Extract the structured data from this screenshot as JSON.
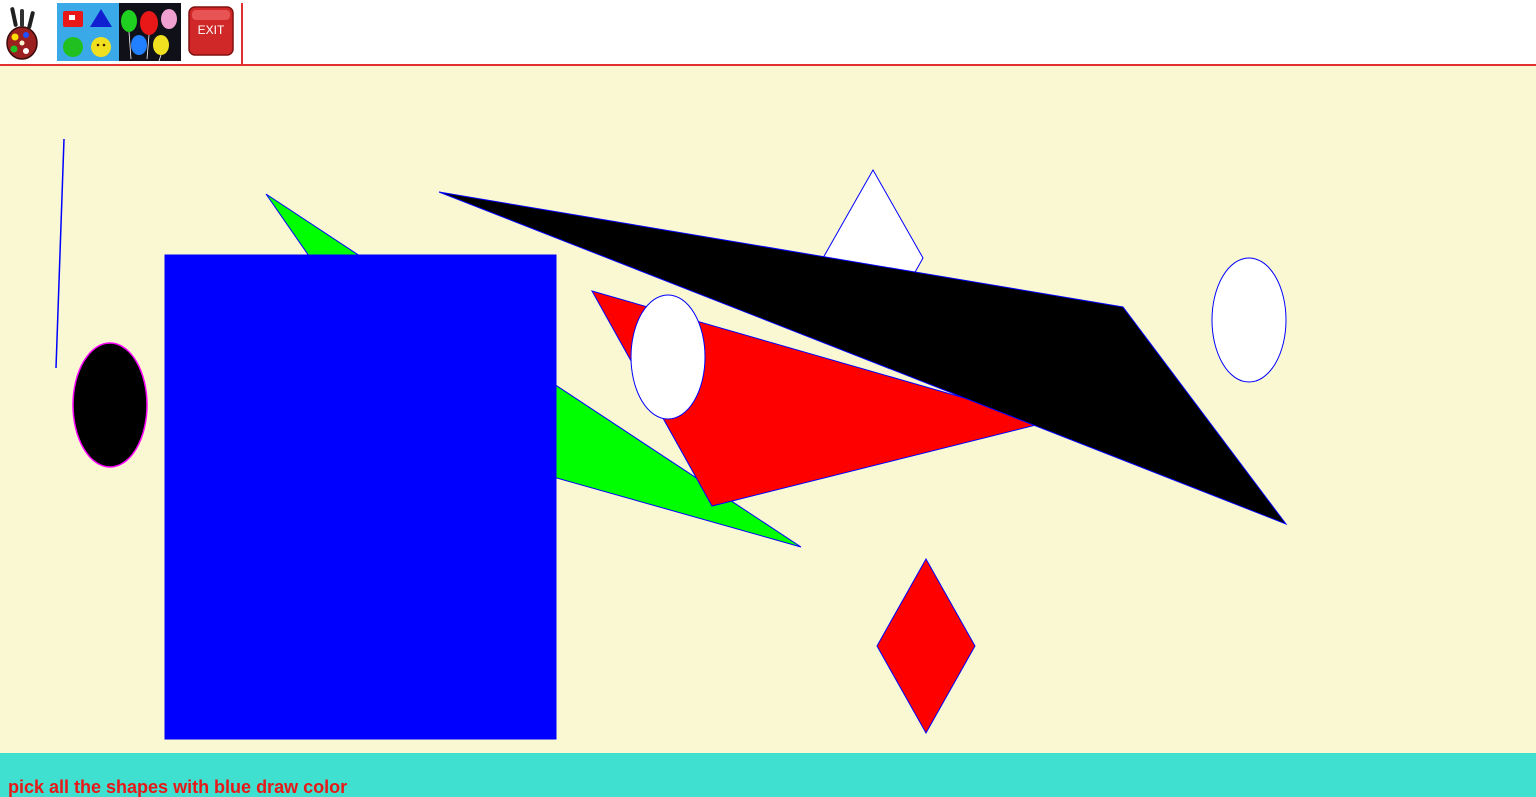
{
  "toolbar": {
    "tools": [
      {
        "name": "palette",
        "icon": "paint-palette-icon"
      },
      {
        "name": "shapes",
        "icon": "shapes-icon"
      },
      {
        "name": "balloons",
        "icon": "balloons-icon"
      },
      {
        "name": "exit",
        "icon": "exit-icon",
        "label": "EXIT"
      }
    ],
    "accent_color": "#e03030"
  },
  "canvas": {
    "background": "#f9f8d2",
    "shapes": [
      {
        "kind": "line",
        "fill": "none",
        "stroke": "#0000ff"
      },
      {
        "kind": "triangle",
        "fill": "#00ff00",
        "stroke": "#0000ff"
      },
      {
        "kind": "rectangle",
        "fill": "#0000ff",
        "stroke": "#0000ff"
      },
      {
        "kind": "ellipse",
        "fill": "#000000",
        "stroke": "#ff00ff"
      },
      {
        "kind": "diamond",
        "fill": "#ffffff",
        "stroke": "#0000ff"
      },
      {
        "kind": "triangle",
        "fill": "#ff0000",
        "stroke": "#0000ff"
      },
      {
        "kind": "ellipse",
        "fill": "#ffffff",
        "stroke": "#0000ff"
      },
      {
        "kind": "triangle",
        "fill": "#000000",
        "stroke": "#0000ff"
      },
      {
        "kind": "ellipse",
        "fill": "#ffffff",
        "stroke": "#0000ff"
      },
      {
        "kind": "diamond",
        "fill": "#ff0000",
        "stroke": "#0000ff"
      }
    ]
  },
  "status_bar": {
    "background": "#40e0d0",
    "instruction": "pick all the shapes with blue draw color"
  }
}
